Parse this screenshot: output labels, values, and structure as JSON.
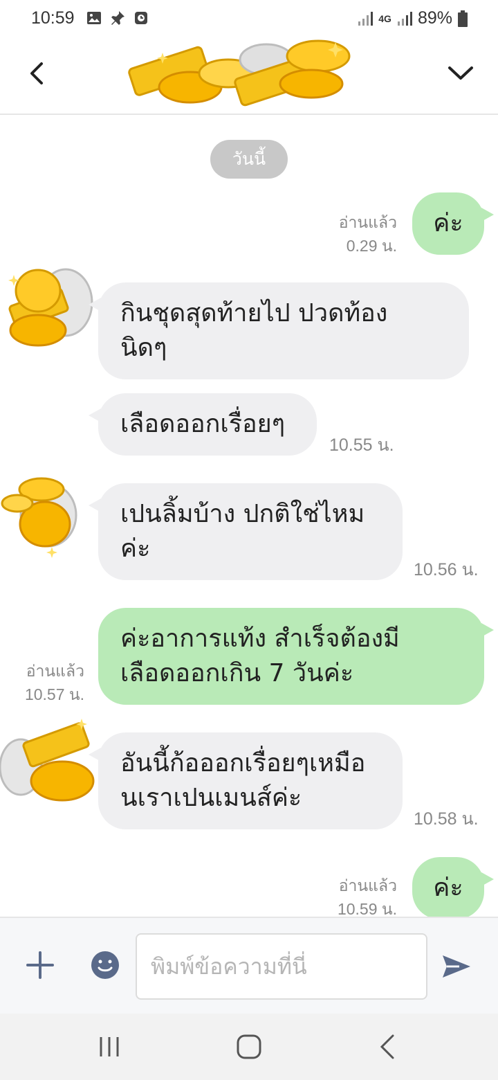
{
  "status_bar": {
    "time": "10:59",
    "battery": "89%",
    "network": "4G"
  },
  "colors": {
    "outgoing_bubble": "#b9eab7",
    "incoming_bubble": "#efeff1",
    "date_pill": "#c8c8c8",
    "accent_icon": "#5a6a8a"
  },
  "chat": {
    "date_label": "วันนี้",
    "messages": [
      {
        "direction": "out",
        "text": "ค่ะ",
        "read": "อ่านแล้ว",
        "time": "0.29 น."
      },
      {
        "direction": "in",
        "text_line1": "กินชุดสุดท้ายไป ปวดท้อง",
        "text_line2": "นิดๆ"
      },
      {
        "direction": "in",
        "text": "เลือดออกเรื่อยๆ",
        "time": "10.55 น."
      },
      {
        "direction": "in",
        "text_line1": "เปนลิ้มบ้าง ปกติใช่ไหม",
        "text_line2": "ค่ะ",
        "time": "10.56 น."
      },
      {
        "direction": "out",
        "text_line1": "ค่ะอาการแท้ง สำเร็จต้องมี",
        "text_line2": "เลือดออกเกิน 7 วันค่ะ",
        "read": "อ่านแล้ว",
        "time": "10.57 น."
      },
      {
        "direction": "in",
        "text_line1": "อันนี้ก้อออกเรื่อยๆเหมือ",
        "text_line2": "นเราเปนเมนส์ค่ะ",
        "time": "10.58 น."
      },
      {
        "direction": "out",
        "text": "ค่ะ",
        "read": "อ่านแล้ว",
        "time": "10.59 น."
      }
    ]
  },
  "input": {
    "placeholder": "พิมพ์ข้อความที่นี่"
  },
  "icons": {
    "back": "chevron-left-icon",
    "expand": "chevron-down-icon",
    "add": "plus-icon",
    "emoji": "smiley-icon",
    "send": "send-icon",
    "nav_recent": "recent-apps-icon",
    "nav_home": "home-icon",
    "nav_back": "back-icon"
  }
}
